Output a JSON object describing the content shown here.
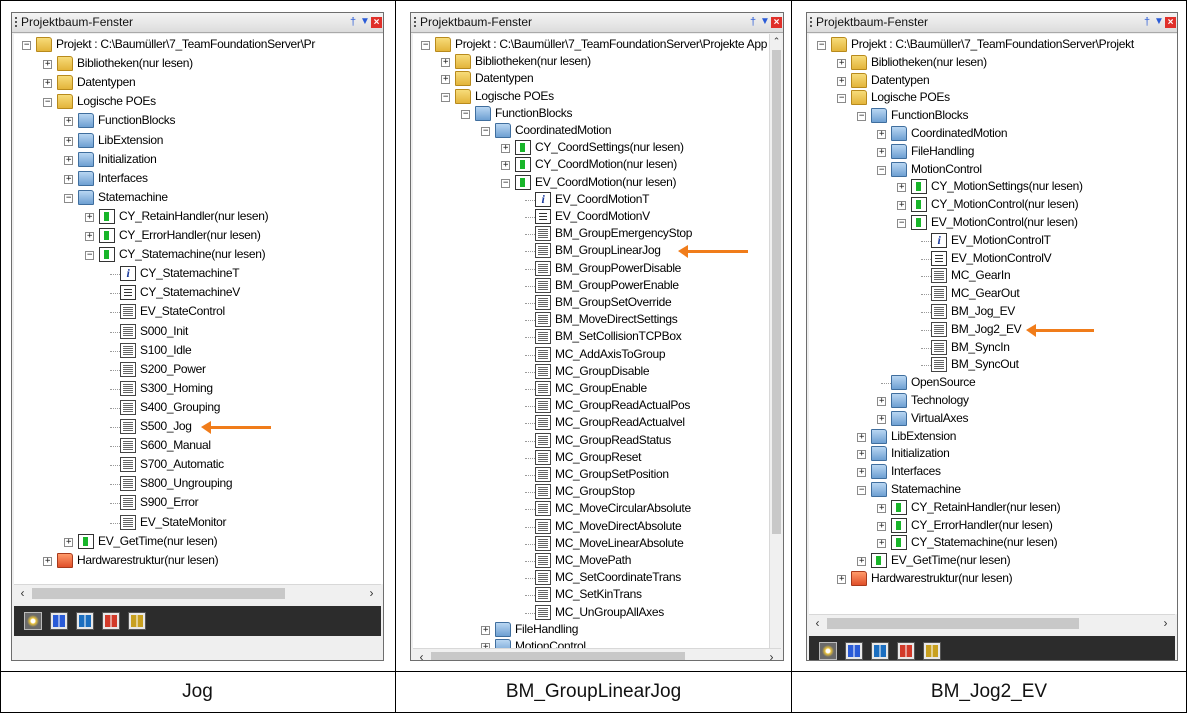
{
  "panels": [
    {
      "title": "Projektbaum-Fenster",
      "caption": "Jog",
      "rows": [
        {
          "d": 0,
          "exp": "-",
          "icon": "folder",
          "text": "Projekt : C:\\Baumüller\\7_TeamFoundationServer\\Pr"
        },
        {
          "d": 1,
          "exp": "+",
          "icon": "folder",
          "text": "Bibliotheken(nur lesen)"
        },
        {
          "d": 1,
          "exp": "+",
          "icon": "folder",
          "text": "Datentypen"
        },
        {
          "d": 1,
          "exp": "-",
          "icon": "folder",
          "text": "Logische POEs"
        },
        {
          "d": 2,
          "exp": "+",
          "icon": "folderblue",
          "text": "FunctionBlocks"
        },
        {
          "d": 2,
          "exp": "+",
          "icon": "folderblue",
          "text": "LibExtension"
        },
        {
          "d": 2,
          "exp": "+",
          "icon": "folderblue",
          "text": "Initialization"
        },
        {
          "d": 2,
          "exp": "+",
          "icon": "folderblue",
          "text": "Interfaces"
        },
        {
          "d": 2,
          "exp": "-",
          "icon": "folderblue",
          "text": "Statemachine"
        },
        {
          "d": 3,
          "exp": "+",
          "icon": "greenbox",
          "text": "CY_RetainHandler(nur lesen)"
        },
        {
          "d": 3,
          "exp": "+",
          "icon": "greenbox",
          "text": "CY_ErrorHandler(nur lesen)"
        },
        {
          "d": 3,
          "exp": "-",
          "icon": "greenbox",
          "text": "CY_Statemachine(nur lesen)"
        },
        {
          "d": 4,
          "exp": "",
          "icon": "info",
          "text": "CY_StatemachineT"
        },
        {
          "d": 4,
          "exp": "",
          "icon": "list",
          "text": "CY_StatemachineV"
        },
        {
          "d": 4,
          "exp": "",
          "icon": "code",
          "text": "EV_StateControl"
        },
        {
          "d": 4,
          "exp": "",
          "icon": "code",
          "text": "S000_Init"
        },
        {
          "d": 4,
          "exp": "",
          "icon": "code",
          "text": "S100_Idle"
        },
        {
          "d": 4,
          "exp": "",
          "icon": "code",
          "text": "S200_Power"
        },
        {
          "d": 4,
          "exp": "",
          "icon": "code",
          "text": "S300_Homing"
        },
        {
          "d": 4,
          "exp": "",
          "icon": "code",
          "text": "S400_Grouping"
        },
        {
          "d": 4,
          "exp": "",
          "icon": "code",
          "text": "S500_Jog",
          "mark": true
        },
        {
          "d": 4,
          "exp": "",
          "icon": "code",
          "text": "S600_Manual"
        },
        {
          "d": 4,
          "exp": "",
          "icon": "code",
          "text": "S700_Automatic"
        },
        {
          "d": 4,
          "exp": "",
          "icon": "code",
          "text": "S800_Ungrouping"
        },
        {
          "d": 4,
          "exp": "",
          "icon": "code",
          "text": "S900_Error"
        },
        {
          "d": 4,
          "exp": "",
          "icon": "code",
          "text": "EV_StateMonitor"
        },
        {
          "d": 2,
          "exp": "+",
          "icon": "greenbox",
          "text": "EV_GetTime(nur lesen)"
        },
        {
          "d": 1,
          "exp": "+",
          "icon": "folderred",
          "text": "Hardwarestruktur(nur lesen)"
        }
      ]
    },
    {
      "title": "Projektbaum-Fenster",
      "caption": "BM_GroupLinearJog",
      "rows": [
        {
          "d": 0,
          "exp": "-",
          "icon": "folder",
          "text": "Projekt : C:\\Baumüller\\7_TeamFoundationServer\\Projekte App"
        },
        {
          "d": 1,
          "exp": "+",
          "icon": "folder",
          "text": "Bibliotheken(nur lesen)"
        },
        {
          "d": 1,
          "exp": "+",
          "icon": "folder",
          "text": "Datentypen"
        },
        {
          "d": 1,
          "exp": "-",
          "icon": "folder",
          "text": "Logische POEs"
        },
        {
          "d": 2,
          "exp": "-",
          "icon": "folderblue",
          "text": "FunctionBlocks"
        },
        {
          "d": 3,
          "exp": "-",
          "icon": "folderblue",
          "text": "CoordinatedMotion"
        },
        {
          "d": 4,
          "exp": "+",
          "icon": "greenbox",
          "text": "CY_CoordSettings(nur lesen)"
        },
        {
          "d": 4,
          "exp": "+",
          "icon": "greenbox",
          "text": "CY_CoordMotion(nur lesen)"
        },
        {
          "d": 4,
          "exp": "-",
          "icon": "greenbox",
          "text": "EV_CoordMotion(nur lesen)"
        },
        {
          "d": 5,
          "exp": "",
          "icon": "info",
          "text": "EV_CoordMotionT"
        },
        {
          "d": 5,
          "exp": "",
          "icon": "list",
          "text": "EV_CoordMotionV"
        },
        {
          "d": 5,
          "exp": "",
          "icon": "code",
          "text": "BM_GroupEmergencyStop"
        },
        {
          "d": 5,
          "exp": "",
          "icon": "code",
          "text": "BM_GroupLinearJog",
          "mark": true
        },
        {
          "d": 5,
          "exp": "",
          "icon": "code",
          "text": "BM_GroupPowerDisable"
        },
        {
          "d": 5,
          "exp": "",
          "icon": "code",
          "text": "BM_GroupPowerEnable"
        },
        {
          "d": 5,
          "exp": "",
          "icon": "code",
          "text": "BM_GroupSetOverride"
        },
        {
          "d": 5,
          "exp": "",
          "icon": "code",
          "text": "BM_MoveDirectSettings"
        },
        {
          "d": 5,
          "exp": "",
          "icon": "code",
          "text": "BM_SetCollisionTCPBox"
        },
        {
          "d": 5,
          "exp": "",
          "icon": "code",
          "text": "MC_AddAxisToGroup"
        },
        {
          "d": 5,
          "exp": "",
          "icon": "code",
          "text": "MC_GroupDisable"
        },
        {
          "d": 5,
          "exp": "",
          "icon": "code",
          "text": "MC_GroupEnable"
        },
        {
          "d": 5,
          "exp": "",
          "icon": "code",
          "text": "MC_GroupReadActualPos"
        },
        {
          "d": 5,
          "exp": "",
          "icon": "code",
          "text": "MC_GroupReadActualvel"
        },
        {
          "d": 5,
          "exp": "",
          "icon": "code",
          "text": "MC_GroupReadStatus"
        },
        {
          "d": 5,
          "exp": "",
          "icon": "code",
          "text": "MC_GroupReset"
        },
        {
          "d": 5,
          "exp": "",
          "icon": "code",
          "text": "MC_GroupSetPosition"
        },
        {
          "d": 5,
          "exp": "",
          "icon": "code",
          "text": "MC_GroupStop"
        },
        {
          "d": 5,
          "exp": "",
          "icon": "code",
          "text": "MC_MoveCircularAbsolute"
        },
        {
          "d": 5,
          "exp": "",
          "icon": "code",
          "text": "MC_MoveDirectAbsolute"
        },
        {
          "d": 5,
          "exp": "",
          "icon": "code",
          "text": "MC_MoveLinearAbsolute"
        },
        {
          "d": 5,
          "exp": "",
          "icon": "code",
          "text": "MC_MovePath"
        },
        {
          "d": 5,
          "exp": "",
          "icon": "code",
          "text": "MC_SetCoordinateTrans"
        },
        {
          "d": 5,
          "exp": "",
          "icon": "code",
          "text": "MC_SetKinTrans"
        },
        {
          "d": 5,
          "exp": "",
          "icon": "code",
          "text": "MC_UnGroupAllAxes"
        },
        {
          "d": 3,
          "exp": "+",
          "icon": "folderblue",
          "text": "FileHandling"
        },
        {
          "d": 3,
          "exp": "+",
          "icon": "folderblue",
          "text": "MotionControl"
        }
      ]
    },
    {
      "title": "Projektbaum-Fenster",
      "caption": "BM_Jog2_EV",
      "rows": [
        {
          "d": 0,
          "exp": "-",
          "icon": "folder",
          "text": "Projekt : C:\\Baumüller\\7_TeamFoundationServer\\Projekt"
        },
        {
          "d": 1,
          "exp": "+",
          "icon": "folder",
          "text": "Bibliotheken(nur lesen)"
        },
        {
          "d": 1,
          "exp": "+",
          "icon": "folder",
          "text": "Datentypen"
        },
        {
          "d": 1,
          "exp": "-",
          "icon": "folder",
          "text": "Logische POEs"
        },
        {
          "d": 2,
          "exp": "-",
          "icon": "folderblue",
          "text": "FunctionBlocks"
        },
        {
          "d": 3,
          "exp": "+",
          "icon": "folderblue",
          "text": "CoordinatedMotion"
        },
        {
          "d": 3,
          "exp": "+",
          "icon": "folderblue",
          "text": "FileHandling"
        },
        {
          "d": 3,
          "exp": "-",
          "icon": "folderblue",
          "text": "MotionControl"
        },
        {
          "d": 4,
          "exp": "+",
          "icon": "greenbox",
          "text": "CY_MotionSettings(nur lesen)"
        },
        {
          "d": 4,
          "exp": "+",
          "icon": "greenbox",
          "text": "CY_MotionControl(nur lesen)"
        },
        {
          "d": 4,
          "exp": "-",
          "icon": "greenbox",
          "text": "EV_MotionControl(nur lesen)"
        },
        {
          "d": 5,
          "exp": "",
          "icon": "info",
          "text": "EV_MotionControlT"
        },
        {
          "d": 5,
          "exp": "",
          "icon": "list",
          "text": "EV_MotionControlV"
        },
        {
          "d": 5,
          "exp": "",
          "icon": "code",
          "text": "MC_GearIn"
        },
        {
          "d": 5,
          "exp": "",
          "icon": "code",
          "text": "MC_GearOut"
        },
        {
          "d": 5,
          "exp": "",
          "icon": "code",
          "text": "BM_Jog_EV"
        },
        {
          "d": 5,
          "exp": "",
          "icon": "code",
          "text": "BM_Jog2_EV",
          "mark": true
        },
        {
          "d": 5,
          "exp": "",
          "icon": "code",
          "text": "BM_SyncIn"
        },
        {
          "d": 5,
          "exp": "",
          "icon": "code",
          "text": "BM_SyncOut"
        },
        {
          "d": 3,
          "exp": "",
          "icon": "folderblue",
          "text": "OpenSource"
        },
        {
          "d": 3,
          "exp": "+",
          "icon": "folderblue",
          "text": "Technology"
        },
        {
          "d": 3,
          "exp": "+",
          "icon": "folderblue",
          "text": "VirtualAxes"
        },
        {
          "d": 2,
          "exp": "+",
          "icon": "folderblue",
          "text": "LibExtension"
        },
        {
          "d": 2,
          "exp": "+",
          "icon": "folderblue",
          "text": "Initialization"
        },
        {
          "d": 2,
          "exp": "+",
          "icon": "folderblue",
          "text": "Interfaces"
        },
        {
          "d": 2,
          "exp": "-",
          "icon": "folderblue",
          "text": "Statemachine"
        },
        {
          "d": 3,
          "exp": "+",
          "icon": "greenbox",
          "text": "CY_RetainHandler(nur lesen)"
        },
        {
          "d": 3,
          "exp": "+",
          "icon": "greenbox",
          "text": "CY_ErrorHandler(nur lesen)"
        },
        {
          "d": 3,
          "exp": "+",
          "icon": "greenbox",
          "text": "CY_Statemachine(nur lesen)"
        },
        {
          "d": 2,
          "exp": "+",
          "icon": "greenbox",
          "text": "EV_GetTime(nur lesen)"
        },
        {
          "d": 1,
          "exp": "+",
          "icon": "folderred",
          "text": "Hardwarestruktur(nur lesen)"
        }
      ]
    }
  ],
  "toolbar_icons": [
    "project-tree-icon",
    "edit-icon",
    "library-icon",
    "hardware-icon",
    "variables-icon"
  ],
  "colors": {
    "arrow": "#f07c1a",
    "toolbar": "#2c2c2c",
    "panel": "#efefef"
  }
}
